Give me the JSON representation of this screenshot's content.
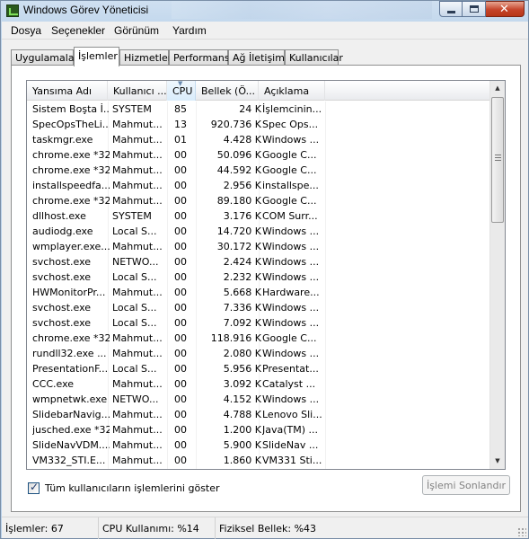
{
  "window": {
    "title": "Windows Görev Yöneticisi"
  },
  "menu": [
    "Dosya",
    "Seçenekler",
    "Görünüm",
    "Yardım"
  ],
  "tabs": [
    "Uygulamalar",
    "İşlemler",
    "Hizmetler",
    "Performans",
    "Ağ İletişimi",
    "Kullanıcılar"
  ],
  "active_tab": "İşlemler",
  "columns": [
    "Yansıma Adı",
    "Kullanıcı ...",
    "CPU",
    "Bellek (Ö...",
    "Açıklama"
  ],
  "sorted_column": "CPU",
  "processes": [
    [
      "Sistem Boşta İ...",
      "SYSTEM",
      "85",
      "24 K",
      "İşlemcinin..."
    ],
    [
      "SpecOpsTheLi...",
      "Mahmut...",
      "13",
      "920.736 K",
      "Spec Ops..."
    ],
    [
      "taskmgr.exe",
      "Mahmut...",
      "01",
      "4.428 K",
      "Windows ..."
    ],
    [
      "chrome.exe *32",
      "Mahmut...",
      "00",
      "50.096 K",
      "Google C..."
    ],
    [
      "chrome.exe *32",
      "Mahmut...",
      "00",
      "44.592 K",
      "Google C..."
    ],
    [
      "installspeedfa...",
      "Mahmut...",
      "00",
      "2.956 K",
      "installspe..."
    ],
    [
      "chrome.exe *32",
      "Mahmut...",
      "00",
      "89.180 K",
      "Google C..."
    ],
    [
      "dllhost.exe",
      "SYSTEM",
      "00",
      "3.176 K",
      "COM Surr..."
    ],
    [
      "audiodg.exe",
      "Local S...",
      "00",
      "14.720 K",
      "Windows ..."
    ],
    [
      "wmplayer.exe...",
      "Mahmut...",
      "00",
      "30.172 K",
      "Windows ..."
    ],
    [
      "svchost.exe",
      "NETWO...",
      "00",
      "2.424 K",
      "Windows ..."
    ],
    [
      "svchost.exe",
      "Local S...",
      "00",
      "2.232 K",
      "Windows ..."
    ],
    [
      "HWMonitorPr...",
      "Mahmut...",
      "00",
      "5.668 K",
      "Hardware..."
    ],
    [
      "svchost.exe",
      "Local S...",
      "00",
      "7.336 K",
      "Windows ..."
    ],
    [
      "svchost.exe",
      "Local S...",
      "00",
      "7.092 K",
      "Windows ..."
    ],
    [
      "chrome.exe *32",
      "Mahmut...",
      "00",
      "118.916 K",
      "Google C..."
    ],
    [
      "rundll32.exe ...",
      "Mahmut...",
      "00",
      "2.080 K",
      "Windows ..."
    ],
    [
      "PresentationF...",
      "Local S...",
      "00",
      "5.956 K",
      "Presentat..."
    ],
    [
      "CCC.exe",
      "Mahmut...",
      "00",
      "3.092 K",
      "Catalyst ..."
    ],
    [
      "wmpnetwk.exe",
      "NETWO...",
      "00",
      "4.152 K",
      "Windows ..."
    ],
    [
      "SlidebarNavig...",
      "Mahmut...",
      "00",
      "4.788 K",
      "Lenovo Sli..."
    ],
    [
      "jusched.exe *32",
      "Mahmut...",
      "00",
      "1.200 K",
      "Java(TM) ..."
    ],
    [
      "SlideNavVDM....",
      "Mahmut...",
      "00",
      "5.900 K",
      "SlideNav ..."
    ],
    [
      "VM332_STI.E...",
      "Mahmut...",
      "00",
      "1.860 K",
      "VM331 Sti..."
    ]
  ],
  "show_all_users": {
    "label": "Tüm kullanıcıların işlemlerini göster",
    "checked": true
  },
  "end_process_button": "İşlemi Sonlandır",
  "status": {
    "processes": "İşlemler: 67",
    "cpu": "CPU Kullanımı: %14",
    "memory": "Fiziksel Bellek: %43"
  }
}
